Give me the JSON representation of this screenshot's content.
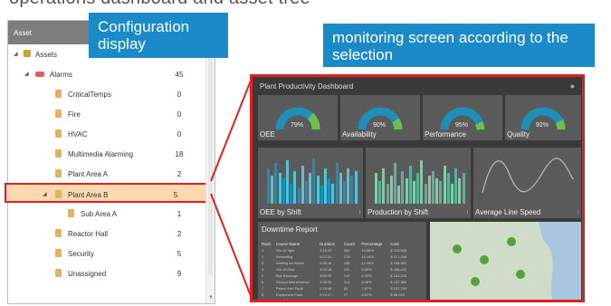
{
  "caption": "operations dashboard and asset tree",
  "tree": {
    "header": "Asset",
    "rows": [
      {
        "label": "Assets",
        "count": ""
      },
      {
        "label": "Alarms",
        "count": "45"
      },
      {
        "label": "CriticalTemps",
        "count": "0"
      },
      {
        "label": "Fire",
        "count": "0"
      },
      {
        "label": "HVAC",
        "count": "0"
      },
      {
        "label": "Multimedia Alarming",
        "count": "18"
      },
      {
        "label": "Plant Area A",
        "count": "2"
      },
      {
        "label": "Plant Area B",
        "count": "5"
      },
      {
        "label": "Sub Area A",
        "count": "1"
      },
      {
        "label": "Reactor Hall",
        "count": "2"
      },
      {
        "label": "Security",
        "count": "5"
      },
      {
        "label": "Unassigned",
        "count": "9"
      }
    ]
  },
  "callouts": {
    "config": "Configuration display",
    "monitor": "monitoring screen according to the selection"
  },
  "dashboard": {
    "title": "Plant Productivity Dashboard",
    "gauges": [
      {
        "label": "OEE",
        "value": "79%"
      },
      {
        "label": "Availability",
        "value": "90%"
      },
      {
        "label": "Performance",
        "value": "95%"
      },
      {
        "label": "Quality",
        "value": "92%"
      }
    ],
    "charts": [
      {
        "label": "OEE by Shift"
      },
      {
        "label": "Production by Shift"
      },
      {
        "label": "Average Line Speed"
      }
    ],
    "downtime": {
      "title": "Downtime Report",
      "columns": [
        "Rank",
        "Cause Name",
        "Duration",
        "Count",
        "Percentage",
        "Cost"
      ],
      "rows": [
        [
          "1",
          "Out of Tape",
          "2:10:23",
          "284",
          "15.88%",
          "$ 315,545"
        ],
        [
          "2",
          "Reloading",
          "4:22:24",
          "276",
          "15.16%",
          "$ 217,356"
        ],
        [
          "3",
          "Waiting for Boxes",
          "4:35:16",
          "188",
          "12.28%",
          "$ 158,982"
        ],
        [
          "4",
          "Out of Glue",
          "4:03:18",
          "150",
          "9.65%",
          "$ 268,432"
        ],
        [
          "5",
          "Box Blockage",
          "3:08:25",
          "140",
          "8.33%",
          "$ 184,220"
        ],
        [
          "6",
          "Scroud Maintenance",
          "3:35:23",
          "114",
          "8.48%",
          "$ 102,383"
        ],
        [
          "7",
          "Reject Arm Fault",
          "2:15:46",
          "82",
          "7.87%",
          "$ 137,753"
        ],
        [
          "8",
          "Equipment Fault",
          "2:02:47",
          "27",
          "3.57%",
          "$ 58,023"
        ]
      ]
    }
  }
}
